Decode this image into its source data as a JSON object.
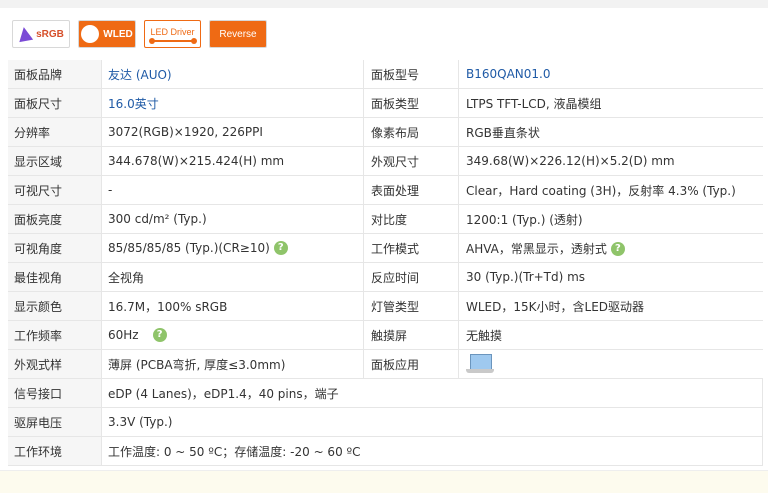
{
  "badges": {
    "srgb": "sRGB",
    "wled": "WLED",
    "driver": "LED Driver",
    "reverse": "Reverse"
  },
  "specs": [
    {
      "k1": "面板品牌",
      "v1": "友达 (AUO)",
      "k2": "面板型号",
      "v2": "B160QAN01.0"
    },
    {
      "k1": "面板尺寸",
      "v1": "16.0英寸",
      "k2": "面板类型",
      "v2": "LTPS TFT-LCD, 液晶模组"
    },
    {
      "k1": "分辨率",
      "v1": "3072(RGB)×1920, 226PPI",
      "k2": "像素布局",
      "v2": "RGB垂直条状"
    },
    {
      "k1": "显示区域",
      "v1": "344.678(W)×215.424(H) mm",
      "k2": "外观尺寸",
      "v2": "349.68(W)×226.12(H)×5.2(D) mm"
    },
    {
      "k1": "可视尺寸",
      "v1": "-",
      "k2": "表面处理",
      "v2": "Clear，Hard coating (3H)，反射率 4.3% (Typ.)"
    },
    {
      "k1": "面板亮度",
      "v1": "300 cd/m² (Typ.)",
      "k2": "对比度",
      "v2": "1200:1 (Typ.) (透射)"
    },
    {
      "k1": "可视角度",
      "v1": "85/85/85/85 (Typ.)(CR≥10)",
      "k2": "工作模式",
      "v2": "AHVA，常黑显示，透射式"
    },
    {
      "k1": "最佳视角",
      "v1": "全视角",
      "k2": "反应时间",
      "v2": "30 (Typ.)(Tr+Td) ms"
    },
    {
      "k1": "显示颜色",
      "v1": "16.7M，100% sRGB",
      "k2": "灯管类型",
      "v2": "WLED，15K小时，含LED驱动器"
    },
    {
      "k1": "工作频率",
      "v1": "60Hz",
      "k2": "触摸屏",
      "v2": "无触摸"
    },
    {
      "k1": "外观式样",
      "v1": "薄屏 (PCBA弯折, 厚度≤3.0mm)",
      "k2": "面板应用",
      "v2": ""
    },
    {
      "k1": "信号接口",
      "v1": "eDP (4 Lanes)，eDP1.4，40 pins，端子"
    },
    {
      "k1": "驱屏电压",
      "v1": "3.3V (Typ.)"
    },
    {
      "k1": "工作环境",
      "v1": "工作温度: 0 ~ 50 ºC；存储温度: -20 ~ 60 ºC"
    }
  ],
  "help_glyph": "?"
}
